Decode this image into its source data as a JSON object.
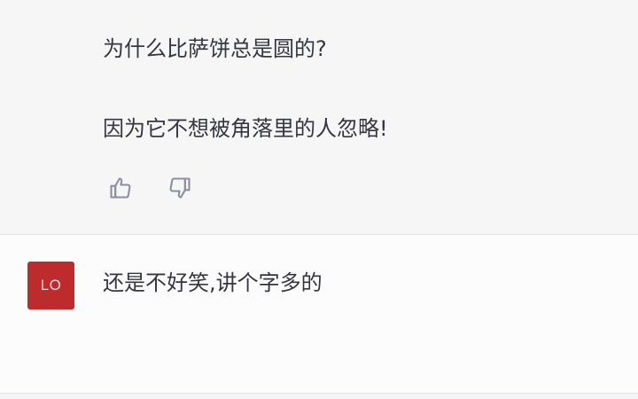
{
  "assistant_message": {
    "line1": "为什么比萨饼总是圆的?",
    "line2": "因为它不想被角落里的人忽略!",
    "feedback": {
      "thumbs_up_icon": "thumbs-up-icon",
      "thumbs_down_icon": "thumbs-down-icon"
    }
  },
  "user_message": {
    "avatar_initials": "LO",
    "avatar_color": "#bd2b2d",
    "text": "还是不好笑,讲个字多的"
  }
}
